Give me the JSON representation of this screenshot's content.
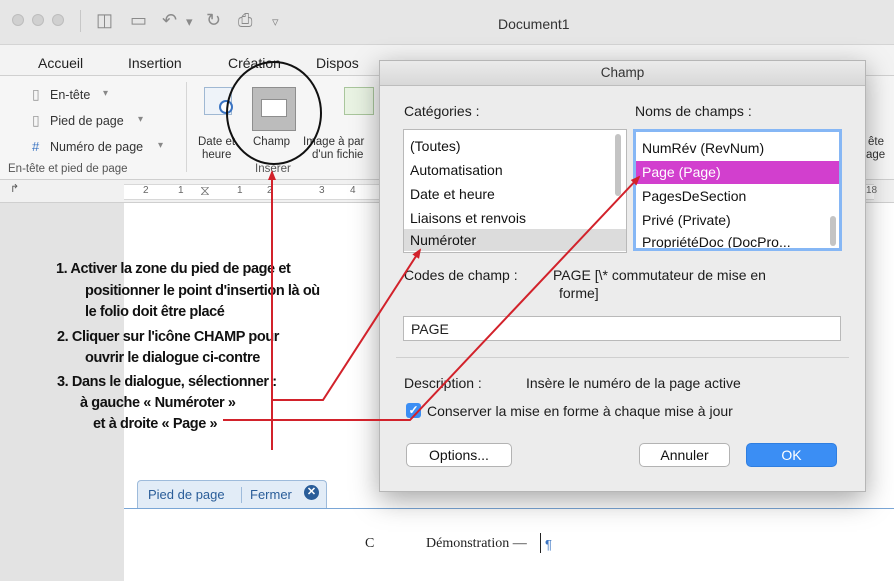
{
  "window": {
    "title": "Document1"
  },
  "ribbon_tabs": [
    "Accueil",
    "Insertion",
    "Création",
    "Dispos"
  ],
  "ribbon": {
    "header_label": "En-tête",
    "footer_label": "Pied de page",
    "page_number_label": "Numéro de page",
    "group_label": "En-tête et pied de page",
    "date_label_1": "Date et",
    "date_label_2": "heure",
    "champ_label": "Champ",
    "image_label_1": "Image à par",
    "image_label_2": "d'un fichie",
    "insert_group_label": "Insérer",
    "right_1": "ête",
    "right_2": "age"
  },
  "ruler": {
    "marks": [
      "2",
      "1",
      "1",
      "2",
      "3",
      "4",
      "18"
    ]
  },
  "instructions": {
    "line1a": "1. Activer la zone du pied de page et",
    "line1b": "positionner le point d'insertion là où",
    "line1c": "le folio doit être placé",
    "line2a": "2. Cliquer sur l'icône CHAMP pour",
    "line2b": "ouvrir le dialogue ci-contre",
    "line3a": "3. Dans le dialogue, sélectionner :",
    "line3b": "à gauche « Numéroter »",
    "line3c": "et à droite « Page »"
  },
  "footer_bar": {
    "label": "Pied de page",
    "close": "Fermer"
  },
  "footer_content": {
    "left_char": "C",
    "text": "Démonstration —",
    "pilcrow": "¶"
  },
  "dialog": {
    "title": "Champ",
    "categories_label": "Catégories :",
    "categories": [
      "(Toutes)",
      "Automatisation",
      "Date et heure",
      "Liaisons et renvois",
      "Numéroter"
    ],
    "selected_category": "Numéroter",
    "fields_label": "Noms de champs :",
    "fields": [
      "NumRév (RevNum)",
      "Page (Page)",
      "PagesDeSection",
      "Privé (Private)",
      "PropriétéDoc (DocPro..."
    ],
    "selected_field": "Page (Page)",
    "codes_label": "Codes de champ :",
    "codes_text_1": "PAGE [\\* commutateur de mise en",
    "codes_text_2": "forme]",
    "codes_value": "PAGE",
    "description_label": "Description :",
    "description_text": "Insère le numéro de la page active",
    "preserve_label": "Conserver la mise en forme à chaque mise à jour",
    "preserve_checked": true,
    "options_button": "Options...",
    "cancel_button": "Annuler",
    "ok_button": "OK"
  },
  "colors": {
    "accent": "#3b8ef4",
    "selection": "#d23fce",
    "arrow": "#d2222b"
  }
}
